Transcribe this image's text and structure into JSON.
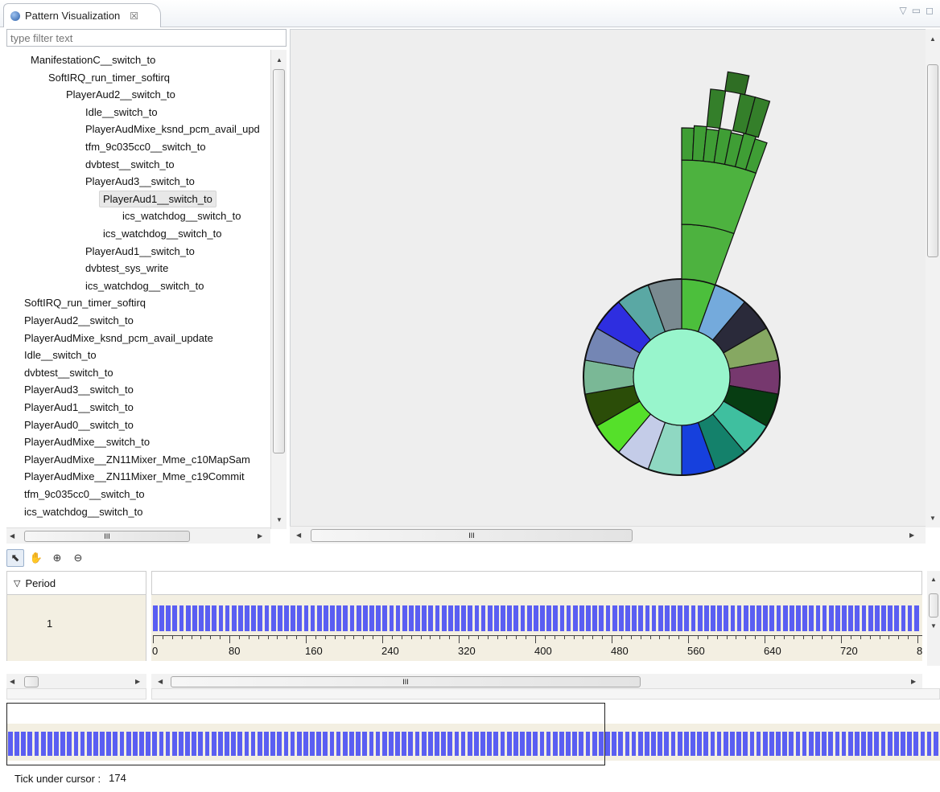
{
  "tab": {
    "title": "Pattern Visualization",
    "close_glyph": "☒"
  },
  "filter": {
    "placeholder": "type filter text"
  },
  "tree": {
    "items": [
      {
        "label": "ManifestationC__switch_to",
        "depth": 1
      },
      {
        "label": "SoftIRQ_run_timer_softirq",
        "depth": 2
      },
      {
        "label": "PlayerAud2__switch_to",
        "depth": 3
      },
      {
        "label": "Idle__switch_to",
        "depth": 4
      },
      {
        "label": "PlayerAudMixe_ksnd_pcm_avail_upd",
        "depth": 4
      },
      {
        "label": "tfm_9c035cc0__switch_to",
        "depth": 4
      },
      {
        "label": "dvbtest__switch_to",
        "depth": 4
      },
      {
        "label": "PlayerAud3__switch_to",
        "depth": 4
      },
      {
        "label": "PlayerAud1__switch_to",
        "depth": 5,
        "selected": true
      },
      {
        "label": "ics_watchdog__switch_to",
        "depth": 6
      },
      {
        "label": "ics_watchdog__switch_to",
        "depth": 5
      },
      {
        "label": "PlayerAud1__switch_to",
        "depth": 4
      },
      {
        "label": "dvbtest_sys_write",
        "depth": 4
      },
      {
        "label": "ics_watchdog__switch_to",
        "depth": 4
      },
      {
        "label": "SoftIRQ_run_timer_softirq",
        "depth": 0
      },
      {
        "label": "PlayerAud2__switch_to",
        "depth": 0
      },
      {
        "label": "PlayerAudMixe_ksnd_pcm_avail_update",
        "depth": 0
      },
      {
        "label": "Idle__switch_to",
        "depth": 0
      },
      {
        "label": "dvbtest__switch_to",
        "depth": 0
      },
      {
        "label": "PlayerAud3__switch_to",
        "depth": 0
      },
      {
        "label": "PlayerAud1__switch_to",
        "depth": 0
      },
      {
        "label": "PlayerAud0__switch_to",
        "depth": 0
      },
      {
        "label": "PlayerAudMixe__switch_to",
        "depth": 0
      },
      {
        "label": "PlayerAudMixe__ZN11Mixer_Mme_c10MapSam",
        "depth": 0
      },
      {
        "label": "PlayerAudMixe__ZN11Mixer_Mme_c19Commit",
        "depth": 0
      },
      {
        "label": "tfm_9c035cc0__switch_to",
        "depth": 0
      },
      {
        "label": "ics_watchdog__switch_to",
        "depth": 0
      }
    ]
  },
  "scroll_thumb_grip": "III",
  "sunburst": {
    "center_color": "#98f5cc",
    "ring_colors": [
      "#4cbf3c",
      "#74aadc",
      "#2a2a3a",
      "#86a862",
      "#76386e",
      "#073d12",
      "#3fbf9f",
      "#14816b",
      "#1640dd",
      "#8fd8c2",
      "#c4cce8",
      "#55e02a",
      "#2b4d08",
      "#7ab896",
      "#7486b4",
      "#2e2ee0",
      "#5aa8a4",
      "#7a8a90"
    ],
    "arm_colors": [
      "#4db23f",
      "#3f9e35",
      "#347f2a",
      "#2f6e24"
    ]
  },
  "toolbar": {
    "tools": [
      {
        "name": "select-tool",
        "glyph": "⬉"
      },
      {
        "name": "pan-tool",
        "glyph": "✋"
      },
      {
        "name": "zoom-in-tool",
        "glyph": "⊕"
      },
      {
        "name": "zoom-out-tool",
        "glyph": "⊖"
      }
    ]
  },
  "period": {
    "header": "Period",
    "toggle_glyph": "▽",
    "row_label": "1",
    "bar_color": "#5a5ef2",
    "ticks": [
      "0",
      "80",
      "160",
      "240",
      "320",
      "400",
      "480",
      "560",
      "640",
      "720",
      "8"
    ]
  },
  "status": {
    "label": "Tick under cursor :",
    "value": "174"
  }
}
